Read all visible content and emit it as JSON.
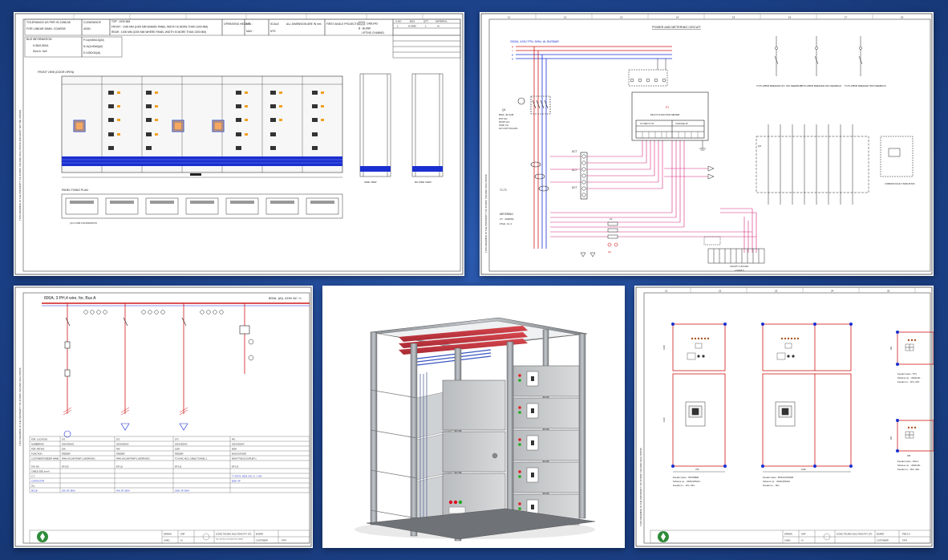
{
  "panels": [
    {
      "id": "ga-drawing",
      "tolerance": "TOLERANCE AS PER IS-2188-08",
      "for_lt": "FOR LINEAR DIMN. COARSE",
      "clearance": "CLEARANCE",
      "clearance_val": "403Ω",
      "top_note": "TOP : 1000 MM",
      "front_note": "FRONT : 1000 MM (1000 MM WHERE PANEL WIDTH IS MORE THAN 1000 MM)",
      "rear_note": "REAR : 1000 MM (1000 MM WHERE PANEL WIDTH IS MORE THAN 1000 MM)",
      "operating_height": "OPERATING HEIGHT",
      "min": "MIN :",
      "max": "MAX :",
      "scale": "SCALE",
      "nts": "NTS",
      "all_dims": "ALL DIMENSION ARE IN mm",
      "first_angle": "FIRST ANGLE PROJECTION",
      "legend_cabling": "CABLING",
      "legend_blank": "B - BLANK",
      "legend_lifting": "LIFTING CHANNEL",
      "bus_info": "BUS INFORMATION",
      "hbus": "H-BUS 800A",
      "size": "Size in 'mm'",
      "bus_p": "P:1x(ex50x10)(Al)",
      "bus_n": "N:1x(1x30x6)(Al)",
      "bus_e": "E:1X50X10(Al)",
      "front_view": "FRONT VIEW (DOOR OPEN)",
      "plinth": "PANEL FIXING PLAN",
      "foundation": "(4) 4 FOR FOUNDATION",
      "side_view": "SIDE VIEW",
      "rh_view": "RH SIDE VIEW",
      "header_cols": [
        "S.NO",
        "BUS",
        "QTY",
        "MATERIAL"
      ],
      "header_vals": [
        "1",
        "H-0040",
        "1",
        "Al"
      ]
    },
    {
      "id": "power-metering",
      "title": "POWER AND METERING CIRCUIT",
      "supply": "2000A, 415V,TPN, 50Hz, AL BUSBAR",
      "phases": [
        "R",
        "Y",
        "B",
        "N"
      ],
      "q1": "Q1",
      "q1_spec": "800A, 4P, ACB",
      "q1_lines": [
        "INST: 6xIn",
        "SHORT: 3xIn",
        "OVER: 1xIn",
        "AUX CONT: 2NO+2NC"
      ],
      "mfm": "MULTI FUNCTION METER",
      "ct_input": "CT INPUT CT1",
      "volt_input": "VOLTAGE I/P",
      "p1": "P1",
      "dct": "DCT",
      "metering": "METERING",
      "ct_spec": "CT : 2000/5A",
      "ct_burden": "15VA, CL:1",
      "t1t3": "T1-T3",
      "fb1": "TO PLC/BMS BREAKER ON / OFF FEEDBACK",
      "fb2": "TO PLC/BMS BREAKER OFF FEEDBACK",
      "fb3": "TO PLC/BMS BREAKER TRIP FEEDBACK",
      "common": "COMMON FAULT INDICATION",
      "q3": "Q3",
      "ctlabel": "CT",
      "cable": "UW-MTY 3.5/3.5D1",
      "sizes": "2.5/4X4.5",
      "q4": "Q4",
      "fuse": "F1",
      "cols": [
        "11",
        "12",
        "13",
        "14",
        "15",
        "16",
        "17",
        "18"
      ]
    },
    {
      "id": "sld",
      "title": "800A, 3 PH,4 wire, for, Bus A",
      "title_right": "800A, (Al), 415V AC +/-",
      "feeder_rows": [
        "FDR. LOCATION",
        "NUMBERING",
        "FDR. RATING",
        "FUNCTION",
        "CUSTOMER FEEDER NAME",
        "TAG NO.",
        "CABLE SIZE (mm²)",
        "C.T.",
        "CONTACTOR",
        "O/L",
        "MCCB",
        "RELAY/OVERLOAD"
      ],
      "feeders": [
        {
          "loc": "1F1",
          "num": "2024/10/5/A1",
          "rating": "63A",
          "func": "FEEDER",
          "name": "RAW VACUM PUMP-1 (WORKING)",
          "tag": "EF-100",
          "mccb": "63A, 3P, 36KA"
        },
        {
          "loc": "1F2",
          "num": "2024/10/5/A2",
          "rating": "40A",
          "func": "FEEDER",
          "name": "RAW VACUM PUMP-2 (WORKING)",
          "tag": "EF-111",
          "mccb": "40A, 3P, 36KA"
        },
        {
          "loc": "1F3",
          "num": "2024/10/5/A3",
          "rating": "160A",
          "func": "FEEDER",
          "name": "TO HVAC MCC CABLE TUNNEL 1",
          "tag": "EF-112",
          "mccb": "250A, 3P, 36KA"
        },
        {
          "loc": "4F1",
          "num": "2024/10/5/A4",
          "rating": "800A",
          "func": "BUSCOUPLER",
          "name": "800A PT BUSCOUPLER 1",
          "tag": "EF-113",
          "mccb": "800A, 4P"
        }
      ],
      "ct_ratio": "T1-T3(TH) : 800/5, 5VA, CL : 1.0VA",
      "company": "ICONIC TECHNO SOLUTIONS PVT. LTD.",
      "address": "104, 1st Floor, Techinuty, Pune 411011",
      "board": "BOARD",
      "customer": "CUSTOMER",
      "drawn": "DRAWN",
      "chkd": "CHKD.",
      "by": "SHP",
      "chk": "SI",
      "tbl_tag": "TATA"
    },
    {
      "id": "render-3d",
      "alt": "3D model of LT switchboard frame"
    },
    {
      "id": "feeder-layout",
      "cols": [
        "21",
        "22",
        "23",
        "24",
        "25"
      ],
      "f1_name": "Feeder name : INCOMER",
      "f1_scheme": "Scheme no. : 2024/10/5/A1",
      "f1_fdr": "Feeder no. : 1F1, 5F1",
      "f2_name": "Feeder name : BUSCOUPLER",
      "f2_scheme": "Scheme no. : 2024/10/5/A2",
      "f2_fdr": "Feeder no. : 4F1",
      "f3_name": "Feeder name : PT1",
      "f3_scheme": "Scheme no. : 2024/10/...",
      "f3_fdr": "Feeder no. : 1F3, 2F3",
      "f4_name": "Feeder name : DOL1",
      "f4_scheme": "Scheme no. : 2024/10/...",
      "f4_fdr": "Feeder no. : 1F2, 2F2",
      "w1": "700",
      "w2": "1100",
      "w3": "455",
      "h1": "1000",
      "h2": "1100",
      "company": "ICONIC TECHNO SOLUTIONS PVT. LTD.",
      "board": "BOARD",
      "customer": "CUSTOMER",
      "drawn": "DRAWN",
      "chkd": "CHKD.",
      "by": "SHP",
      "chk": "SI",
      "tbl_tag": "TATA",
      "pmcc": "PMCC A"
    }
  ],
  "colors": {
    "background": "#1e4590",
    "wire_red": "#d01818",
    "wire_blue": "#1a2fd0",
    "wire_pink": "#d6287a",
    "busbar_blue": "#1a2fd0"
  }
}
